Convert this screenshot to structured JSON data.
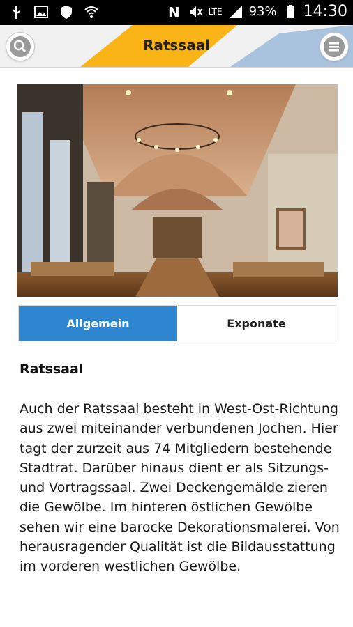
{
  "status_bar": {
    "battery": "93%",
    "time": "14:30",
    "network": "LTE",
    "icons": [
      "usb-icon",
      "image-icon",
      "shield-icon",
      "wifi-icon",
      "nfc-icon",
      "mute-icon",
      "signal-icon",
      "battery-icon"
    ]
  },
  "header": {
    "title": "Ratssaal",
    "accent_color": "#fbb417",
    "secondary_color": "#a9c3df"
  },
  "tabs": [
    {
      "label": "Allgemein",
      "active": true
    },
    {
      "label": "Exponate",
      "active": false
    }
  ],
  "content": {
    "heading": "Ratssaal",
    "paragraph": "Auch der Ratssaal besteht in West-Ost-Richtung aus zwei miteinander verbundenen Jochen. Hier tagt der zurzeit aus 74 Mitgliedern bestehende Stadtrat. Darüber hinaus dient er als Sitzungs- und Vortragssaal. Zwei Deckengemälde zieren die Gewölbe. Im hinteren östlichen Gewölbe sehen wir eine barocke Dekorationsmalerei. Von herausragender Qualität ist die Bildausstattung im vorderen westlichen Gewölbe."
  }
}
